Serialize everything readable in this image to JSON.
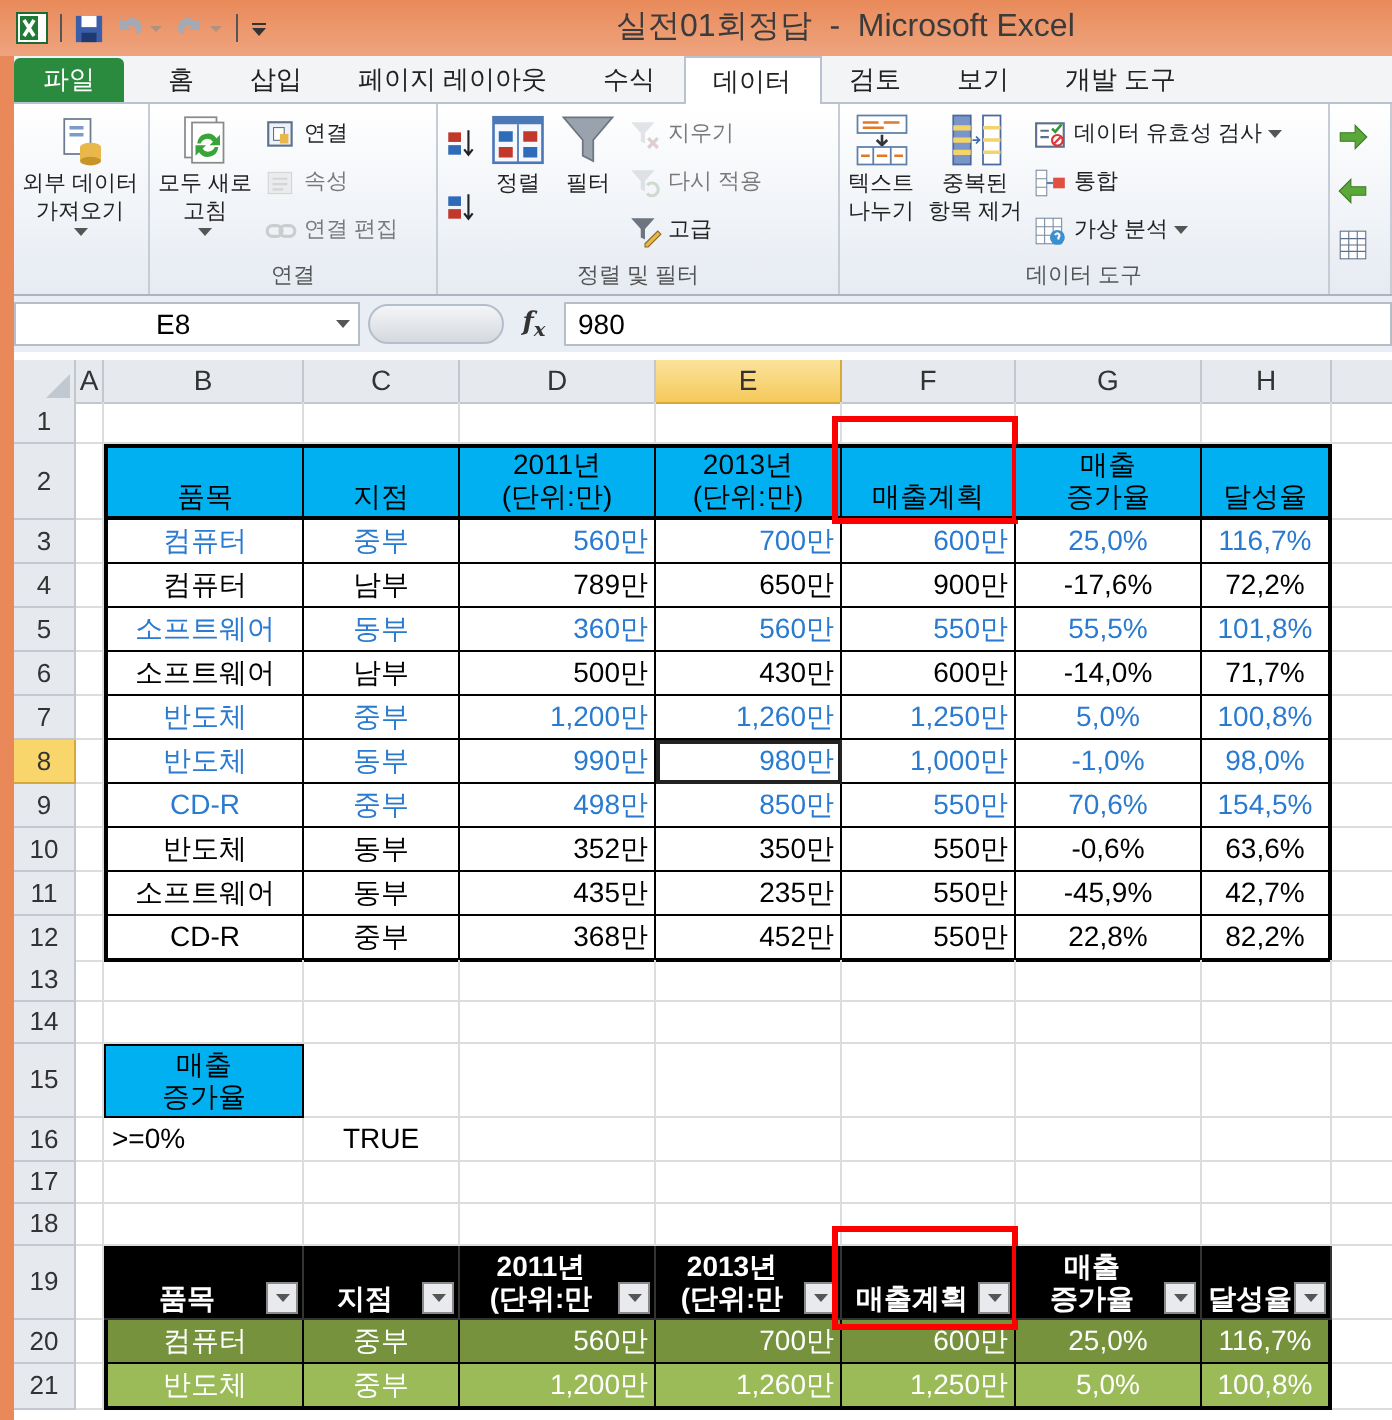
{
  "title_bar": {
    "title": "실전01회정답  -  Microsoft Excel"
  },
  "ribbon": {
    "tabs": [
      {
        "label": "파일",
        "kind": "file",
        "selected": false
      },
      {
        "label": "홈",
        "kind": "tab",
        "selected": false
      },
      {
        "label": "삽입",
        "kind": "tab",
        "selected": false
      },
      {
        "label": "페이지 레이아웃",
        "kind": "tab",
        "selected": false
      },
      {
        "label": "수식",
        "kind": "tab",
        "selected": false
      },
      {
        "label": "데이터",
        "kind": "tab",
        "selected": true
      },
      {
        "label": "검토",
        "kind": "tab",
        "selected": false
      },
      {
        "label": "보기",
        "kind": "tab",
        "selected": false
      },
      {
        "label": "개발 도구",
        "kind": "tab",
        "selected": false
      }
    ],
    "groups": [
      {
        "buttons": [
          {
            "kind": "large",
            "label": "외부 데이터\n가져오기",
            "dropdown": true,
            "disabled": false
          }
        ]
      },
      {
        "label": "연결",
        "buttons": [
          {
            "kind": "large",
            "label": "모두 새로\n고침",
            "dropdown": true,
            "disabled": false
          },
          {
            "kind": "small",
            "label": "연결",
            "dropdown": false,
            "disabled": false
          },
          {
            "kind": "small",
            "label": "속성",
            "dropdown": false,
            "disabled": true
          },
          {
            "kind": "small",
            "label": "연결 편집",
            "dropdown": false,
            "disabled": true
          }
        ]
      },
      {
        "label": "정렬 및 필터",
        "buttons": [
          {
            "kind": "icon",
            "dropdown": false,
            "disabled": false
          },
          {
            "kind": "icon",
            "dropdown": false,
            "disabled": false
          },
          {
            "kind": "large",
            "label": "정렬",
            "dropdown": false,
            "disabled": false
          },
          {
            "kind": "large",
            "label": "필터",
            "dropdown": false,
            "disabled": false
          },
          {
            "kind": "small",
            "label": "지우기",
            "dropdown": false,
            "disabled": true
          },
          {
            "kind": "small",
            "label": "다시 적용",
            "dropdown": false,
            "disabled": true
          },
          {
            "kind": "small",
            "label": "고급",
            "dropdown": false,
            "disabled": false
          }
        ]
      },
      {
        "label": "데이터 도구",
        "buttons": [
          {
            "kind": "large",
            "label": "텍스트\n나누기",
            "dropdown": false,
            "disabled": false
          },
          {
            "kind": "large",
            "label": "중복된\n항목 제거",
            "dropdown": false,
            "disabled": false
          },
          {
            "kind": "small",
            "label": "데이터 유효성 검사",
            "dropdown": true,
            "disabled": false
          },
          {
            "kind": "small",
            "label": "통합",
            "dropdown": false,
            "disabled": false
          },
          {
            "kind": "small",
            "label": "가상 분석",
            "dropdown": true,
            "disabled": false
          }
        ]
      },
      {
        "buttons": [
          {
            "kind": "icon",
            "dropdown": false,
            "disabled": false
          },
          {
            "kind": "icon",
            "dropdown": false,
            "disabled": false
          },
          {
            "kind": "icon",
            "dropdown": false,
            "disabled": false
          }
        ]
      }
    ]
  },
  "formula_bar": {
    "name_box": "E8",
    "fx_label": "f$_{x}$",
    "value": "980"
  },
  "columns": [
    {
      "label": "A",
      "selected": false
    },
    {
      "label": "B",
      "selected": false
    },
    {
      "label": "C",
      "selected": false
    },
    {
      "label": "D",
      "selected": false
    },
    {
      "label": "E",
      "selected": true
    },
    {
      "label": "F",
      "selected": false
    },
    {
      "label": "G",
      "selected": false
    },
    {
      "label": "H",
      "selected": false
    }
  ],
  "sheet": {
    "rows": [
      {
        "number": "1",
        "selected": false,
        "kind": "empty"
      },
      {
        "number": "2",
        "selected": false,
        "kind": "table_header",
        "cells": [
          {
            "text": "품목",
            "outlined": false
          },
          {
            "text": "지점",
            "outlined": false
          },
          {
            "text": "2011년\n(단위:만)",
            "outlined": false
          },
          {
            "text": "2013년\n(단위:만)",
            "outlined": false
          },
          {
            "text": "매출계획",
            "outlined": true
          },
          {
            "text": "매출\n증가율",
            "outlined": false
          },
          {
            "text": "달성율",
            "outlined": false
          }
        ]
      },
      {
        "number": "3",
        "selected": false,
        "kind": "table_row",
        "highlighted": true,
        "cells": [
          {
            "text": "컴퓨터",
            "selected": false
          },
          {
            "text": "중부",
            "selected": false
          },
          {
            "text": "560만",
            "selected": false
          },
          {
            "text": "700만",
            "selected": false
          },
          {
            "text": "600만",
            "selected": false
          },
          {
            "text": "25,0%",
            "selected": false
          },
          {
            "text": "116,7%",
            "selected": false
          }
        ]
      },
      {
        "number": "4",
        "selected": false,
        "kind": "table_row",
        "highlighted": false,
        "cells": [
          {
            "text": "컴퓨터",
            "selected": false
          },
          {
            "text": "남부",
            "selected": false
          },
          {
            "text": "789만",
            "selected": false
          },
          {
            "text": "650만",
            "selected": false
          },
          {
            "text": "900만",
            "selected": false
          },
          {
            "text": "-17,6%",
            "selected": false
          },
          {
            "text": "72,2%",
            "selected": false
          }
        ]
      },
      {
        "number": "5",
        "selected": false,
        "kind": "table_row",
        "highlighted": true,
        "cells": [
          {
            "text": "소프트웨어",
            "selected": false
          },
          {
            "text": "동부",
            "selected": false
          },
          {
            "text": "360만",
            "selected": false
          },
          {
            "text": "560만",
            "selected": false
          },
          {
            "text": "550만",
            "selected": false
          },
          {
            "text": "55,5%",
            "selected": false
          },
          {
            "text": "101,8%",
            "selected": false
          }
        ]
      },
      {
        "number": "6",
        "selected": false,
        "kind": "table_row",
        "highlighted": false,
        "cells": [
          {
            "text": "소프트웨어",
            "selected": false
          },
          {
            "text": "남부",
            "selected": false
          },
          {
            "text": "500만",
            "selected": false
          },
          {
            "text": "430만",
            "selected": false
          },
          {
            "text": "600만",
            "selected": false
          },
          {
            "text": "-14,0%",
            "selected": false
          },
          {
            "text": "71,7%",
            "selected": false
          }
        ]
      },
      {
        "number": "7",
        "selected": false,
        "kind": "table_row",
        "highlighted": true,
        "cells": [
          {
            "text": "반도체",
            "selected": false
          },
          {
            "text": "중부",
            "selected": false
          },
          {
            "text": "1,200만",
            "selected": false
          },
          {
            "text": "1,260만",
            "selected": false
          },
          {
            "text": "1,250만",
            "selected": false
          },
          {
            "text": "5,0%",
            "selected": false
          },
          {
            "text": "100,8%",
            "selected": false
          }
        ]
      },
      {
        "number": "8",
        "selected": true,
        "kind": "table_row",
        "highlighted": true,
        "cells": [
          {
            "text": "반도체",
            "selected": false
          },
          {
            "text": "동부",
            "selected": false
          },
          {
            "text": "990만",
            "selected": false
          },
          {
            "text": "980만",
            "selected": true
          },
          {
            "text": "1,000만",
            "selected": false
          },
          {
            "text": "-1,0%",
            "selected": false
          },
          {
            "text": "98,0%",
            "selected": false
          }
        ]
      },
      {
        "number": "9",
        "selected": false,
        "kind": "table_row",
        "highlighted": true,
        "cells": [
          {
            "text": "CD-R",
            "selected": false
          },
          {
            "text": "중부",
            "selected": false
          },
          {
            "text": "498만",
            "selected": false
          },
          {
            "text": "850만",
            "selected": false
          },
          {
            "text": "550만",
            "selected": false
          },
          {
            "text": "70,6%",
            "selected": false
          },
          {
            "text": "154,5%",
            "selected": false
          }
        ]
      },
      {
        "number": "10",
        "selected": false,
        "kind": "table_row",
        "highlighted": false,
        "cells": [
          {
            "text": "반도체",
            "selected": false
          },
          {
            "text": "동부",
            "selected": false
          },
          {
            "text": "352만",
            "selected": false
          },
          {
            "text": "350만",
            "selected": false
          },
          {
            "text": "550만",
            "selected": false
          },
          {
            "text": "-0,6%",
            "selected": false
          },
          {
            "text": "63,6%",
            "selected": false
          }
        ]
      },
      {
        "number": "11",
        "selected": false,
        "kind": "table_row",
        "highlighted": false,
        "cells": [
          {
            "text": "소프트웨어",
            "selected": false
          },
          {
            "text": "동부",
            "selected": false
          },
          {
            "text": "435만",
            "selected": false
          },
          {
            "text": "235만",
            "selected": false
          },
          {
            "text": "550만",
            "selected": false
          },
          {
            "text": "-45,9%",
            "selected": false
          },
          {
            "text": "42,7%",
            "selected": false
          }
        ]
      },
      {
        "number": "12",
        "selected": false,
        "kind": "table_row",
        "highlighted": false,
        "cells": [
          {
            "text": "CD-R",
            "selected": false
          },
          {
            "text": "중부",
            "selected": false
          },
          {
            "text": "368만",
            "selected": false
          },
          {
            "text": "452만",
            "selected": false
          },
          {
            "text": "550만",
            "selected": false
          },
          {
            "text": "22,8%",
            "selected": false
          },
          {
            "text": "82,2%",
            "selected": false
          }
        ]
      },
      {
        "number": "13",
        "selected": false,
        "kind": "empty"
      },
      {
        "number": "14",
        "selected": false,
        "kind": "empty"
      },
      {
        "number": "15",
        "selected": false,
        "kind": "criteria_header",
        "cells": [
          {
            "text": "매출\n증가율"
          }
        ]
      },
      {
        "number": "16",
        "selected": false,
        "kind": "criteria_value",
        "cells": [
          {
            "text": ">=0%"
          },
          {
            "text": "TRUE"
          }
        ]
      },
      {
        "number": "17",
        "selected": false,
        "kind": "empty"
      },
      {
        "number": "18",
        "selected": false,
        "kind": "empty"
      },
      {
        "number": "19",
        "selected": false,
        "kind": "filter_header",
        "cells": [
          {
            "text": "품목",
            "outlined": false
          },
          {
            "text": "지점",
            "outlined": false
          },
          {
            "text": "2011년\n(단위:만",
            "outlined": false
          },
          {
            "text": "2013년\n(단위:만",
            "outlined": false
          },
          {
            "text": "매출계획",
            "outlined": true
          },
          {
            "text": "매출\n증가율",
            "outlined": false
          },
          {
            "text": "달성율",
            "outlined": false
          }
        ]
      },
      {
        "number": "20",
        "selected": false,
        "kind": "filter_row",
        "color": "#76923c",
        "cells": [
          {
            "text": "컴퓨터"
          },
          {
            "text": "중부"
          },
          {
            "text": "560만"
          },
          {
            "text": "700만"
          },
          {
            "text": "600만"
          },
          {
            "text": "25,0%"
          },
          {
            "text": "116,7%"
          }
        ]
      },
      {
        "number": "21",
        "selected": false,
        "kind": "filter_row",
        "color": "#9bbb59",
        "cells": [
          {
            "text": "반도체"
          },
          {
            "text": "중부"
          },
          {
            "text": "1,200만"
          },
          {
            "text": "1,260만"
          },
          {
            "text": "1,250만"
          },
          {
            "text": "5,0%"
          },
          {
            "text": "100,8%"
          }
        ]
      }
    ]
  }
}
